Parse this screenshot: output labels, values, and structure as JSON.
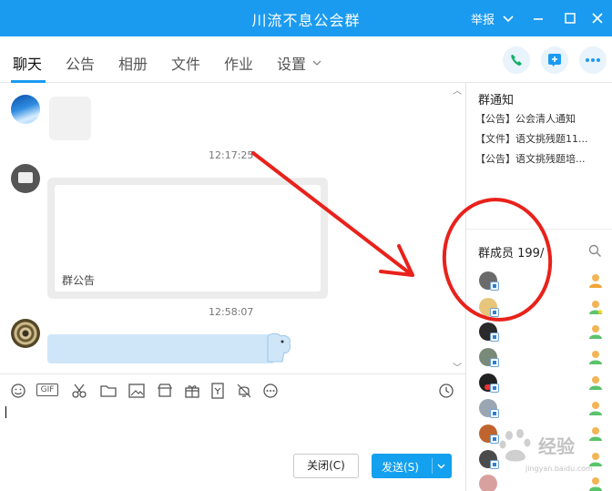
{
  "window": {
    "title": "川流不息公会群",
    "report_label": "举报",
    "title_bar_color": "#1b9bf0"
  },
  "tabs": [
    {
      "label": "聊天",
      "active": true
    },
    {
      "label": "公告",
      "active": false
    },
    {
      "label": "相册",
      "active": false
    },
    {
      "label": "文件",
      "active": false
    },
    {
      "label": "作业",
      "active": false
    },
    {
      "label": "设置",
      "active": false
    }
  ],
  "tab_actions": {
    "call_icon": "phone-icon",
    "add_icon": "add-square-icon",
    "more_icon": "ellipsis-icon"
  },
  "chat": {
    "messages": [
      {
        "timestamp": "12:17:25",
        "card_label": "群公告"
      },
      {
        "timestamp": "12:58:07"
      }
    ]
  },
  "group_notice": {
    "title": "群通知",
    "items": [
      "【公告】公会清人通知",
      "【文件】语文挑残题11...",
      "【公告】语文挑残题培..."
    ]
  },
  "members": {
    "title": "群成员 199/",
    "search_icon": "search-icon",
    "count_rows": 9
  },
  "toolbar": {
    "gif_label": "GIF",
    "icons": [
      "emoji-icon",
      "gif-icon",
      "scissors-icon",
      "folder-icon",
      "image-icon",
      "shop-icon",
      "gift-icon",
      "doc-icon",
      "bell-icon",
      "more-circle-icon",
      "clock-icon"
    ]
  },
  "buttons": {
    "close_label": "关闭(C)",
    "send_label": "发送(S)"
  },
  "annotation": {
    "arrow_color": "#e8221b",
    "circle_color": "#e8221b"
  },
  "watermark_text": "经验",
  "watermark_sub": "jingyan.baidu.com"
}
